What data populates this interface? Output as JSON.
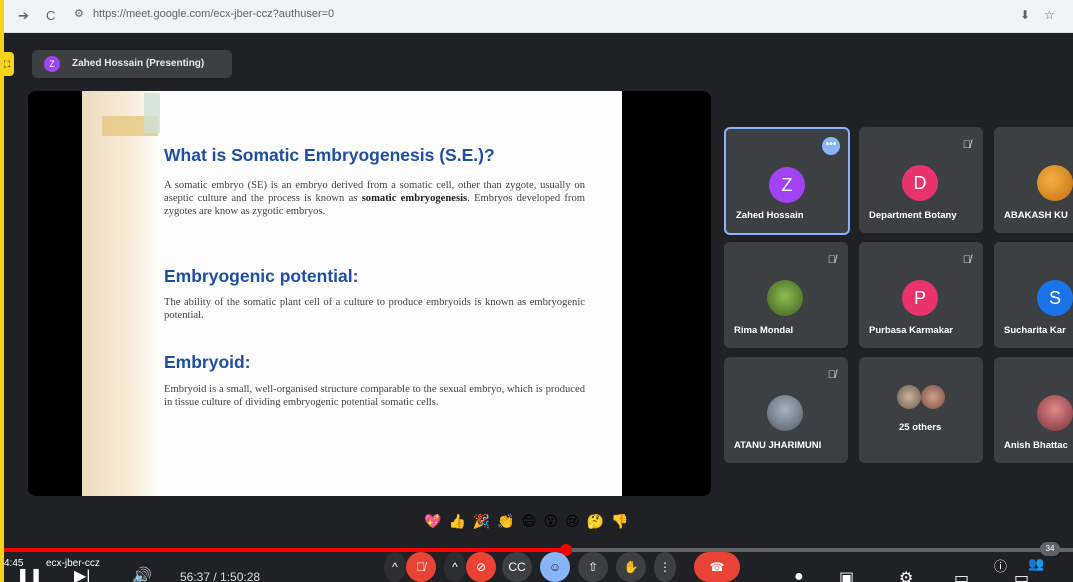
{
  "browser": {
    "back": "➔",
    "reload": "C",
    "url": "https://meet.google.com/ecx-jber-ccz?authuser=0",
    "download_icon": "⬇",
    "star_icon": "☆"
  },
  "meet": {
    "presenter_initial": "Z",
    "presenter_label": "Zahed Hossain (Presenting)"
  },
  "slide": {
    "heading1": "What is Somatic Embryogenesis (S.E.)?",
    "para1_a": "A somatic embryo (SE) is an embryo derived from a somatic cell, other than zygote, usually on aseptic culture and the process is known as ",
    "para1_bold": "somatic embryogenesis",
    "para1_b": ". Embryos developed from zygotes are know as zygotic embryos.",
    "heading2": "Embryogenic potential:",
    "para2": "The ability of the somatic plant cell of a culture to produce embryoids is known as embryogenic potential.",
    "heading3": "Embryoid:",
    "para3": "Embryoid is a small, well-organised structure comparable to the sexual embryo, which is produced in tissue culture of dividing embryogenic potential somatic cells."
  },
  "participants": [
    {
      "name": "Zahed Hossain",
      "initial": "Z",
      "color": "#a142f4",
      "type": "initial"
    },
    {
      "name": "Department Botany",
      "initial": "D",
      "color": "#e8336d",
      "type": "initial"
    },
    {
      "name": "ABAKASH KU",
      "initial": "",
      "color": "#e69a3a",
      "type": "photo"
    },
    {
      "name": "Rima Mondal",
      "initial": "",
      "color": "#5a7d3a",
      "type": "photo"
    },
    {
      "name": "Purbasa Karmakar",
      "initial": "P",
      "color": "#e8336d",
      "type": "initial"
    },
    {
      "name": "Sucharita Kar",
      "initial": "S",
      "color": "#1a73e8",
      "type": "initial"
    },
    {
      "name": "ATANU JHARIMUNI",
      "initial": "",
      "color": "#7d8896",
      "type": "photo"
    },
    {
      "name": "25 others",
      "initial": "",
      "color": "#8a7d70",
      "type": "group"
    },
    {
      "name": "Anish Bhattac",
      "initial": "",
      "color": "#b04a5a",
      "type": "photo"
    }
  ],
  "reactions": [
    "💖",
    "👍",
    "🎉",
    "👏",
    "😄",
    "😮",
    "😢",
    "🤔",
    "👎"
  ],
  "player": {
    "time_left": "4:45",
    "meeting_code": "ecx-jber-ccz",
    "timestamp": "56:37 / 1:50:28",
    "participant_count": "34",
    "progress": 0.526
  },
  "colors": {
    "accent_blue": "#1f4fa0",
    "leave_red": "#ea4335",
    "frame_yellow": "#f7d21c"
  }
}
